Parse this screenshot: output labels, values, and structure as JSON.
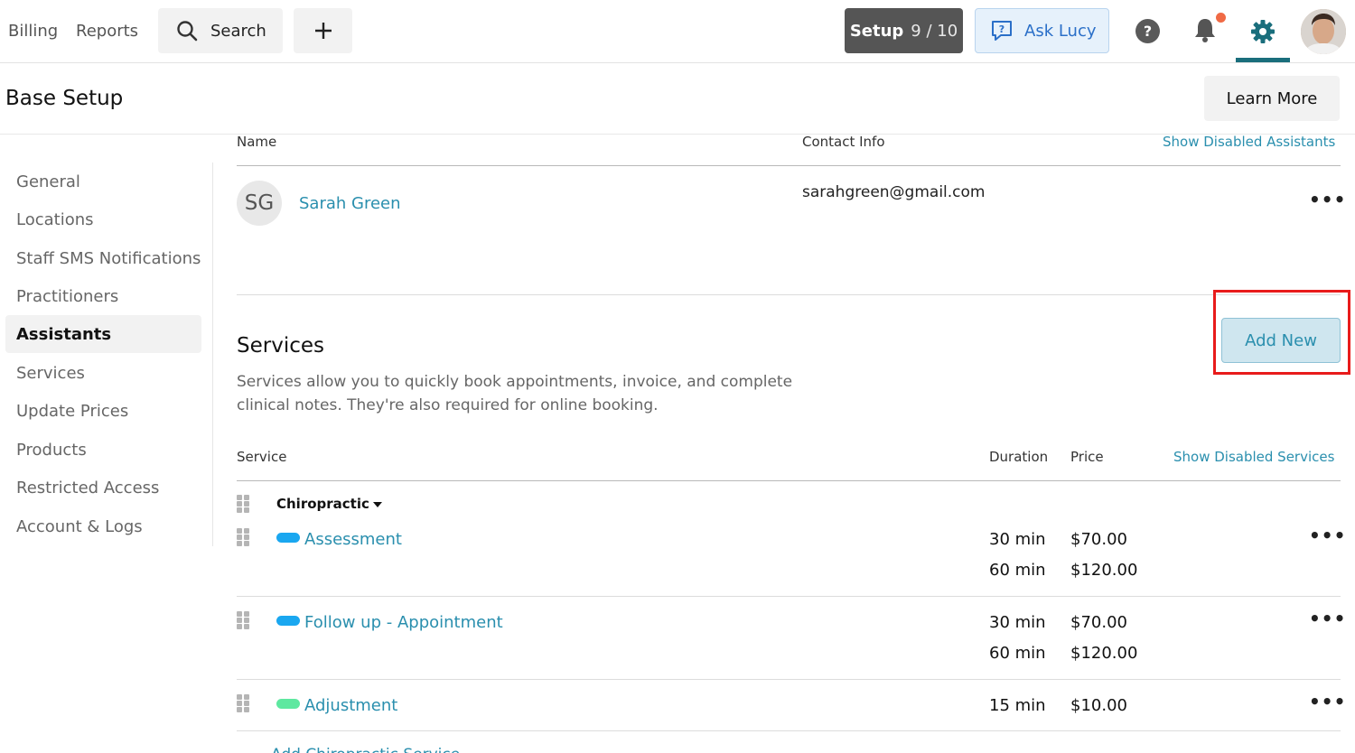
{
  "nav": {
    "billing": "Billing",
    "reports": "Reports",
    "search": "Search",
    "setup_label": "Setup",
    "setup_progress": "9 / 10",
    "ask_lucy": "Ask Lucy",
    "help": "?"
  },
  "colors": {
    "accent": "#2a8fae",
    "teal": "#1a6e7c",
    "highlight": "#e81b1b",
    "notify": "#f06a45"
  },
  "page": {
    "title": "Base Setup",
    "learn_more": "Learn More"
  },
  "sidebar": {
    "items": [
      {
        "label": "General"
      },
      {
        "label": "Locations"
      },
      {
        "label": "Staff SMS Notifications"
      },
      {
        "label": "Practitioners"
      },
      {
        "label": "Assistants"
      },
      {
        "label": "Services"
      },
      {
        "label": "Update Prices"
      },
      {
        "label": "Products"
      },
      {
        "label": "Restricted Access"
      },
      {
        "label": "Account & Logs"
      }
    ],
    "active": "Assistants"
  },
  "assistants": {
    "columns": [
      "Name",
      "Contact Info"
    ],
    "show_disabled": "Show Disabled Assistants",
    "rows": [
      {
        "initials": "SG",
        "name": "Sarah Green",
        "email": "sarahgreen@gmail.com"
      }
    ]
  },
  "services": {
    "title": "Services",
    "description": "Services allow you to quickly book appointments, invoice, and complete clinical notes. They're also required for online booking.",
    "add_new": "Add New",
    "columns": [
      "Service",
      "Duration",
      "Price"
    ],
    "show_disabled": "Show Disabled Services",
    "category": "Chiropractic",
    "items": [
      {
        "name": "Assessment",
        "color": "#1aa7f0",
        "rates": [
          {
            "duration": "30 min",
            "price": "$70.00"
          },
          {
            "duration": "60 min",
            "price": "$120.00"
          }
        ]
      },
      {
        "name": "Follow up - Appointment",
        "color": "#1aa7f0",
        "rates": [
          {
            "duration": "30 min",
            "price": "$70.00"
          },
          {
            "duration": "60 min",
            "price": "$120.00"
          }
        ]
      },
      {
        "name": "Adjustment",
        "color": "#5ee8a0",
        "rates": [
          {
            "duration": "15 min",
            "price": "$10.00"
          }
        ]
      }
    ],
    "add_service": "Add Chiropractic Service"
  }
}
